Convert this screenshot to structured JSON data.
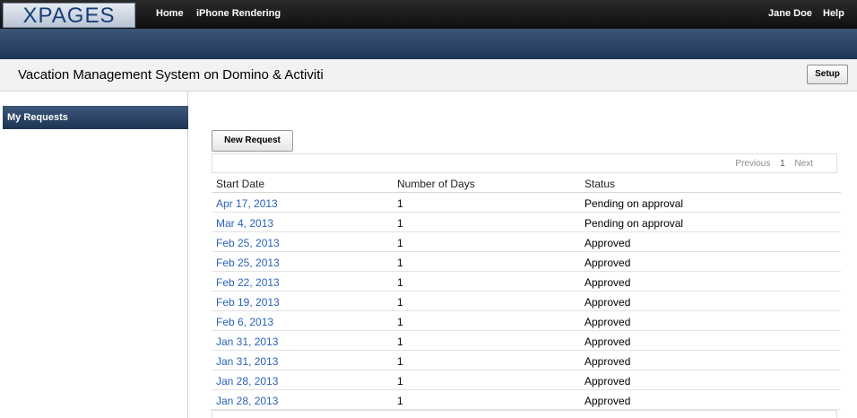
{
  "banner": {
    "logo_text": "XPAGES",
    "nav": [
      "Home",
      "iPhone Rendering"
    ],
    "user": "Jane Doe",
    "help": "Help"
  },
  "placebar": {
    "title": "Vacation Management System on Domino & Activiti",
    "setup_label": "Setup"
  },
  "leftnav": {
    "items": [
      {
        "label": "My Requests",
        "selected": true
      }
    ]
  },
  "main": {
    "new_request_label": "New Request",
    "pager": {
      "previous": "Previous",
      "current": "1",
      "next": "Next"
    },
    "columns": [
      "Start Date",
      "Number of Days",
      "Status"
    ],
    "rows": [
      {
        "date": "Apr 17, 2013",
        "days": "1",
        "status": "Pending on approval"
      },
      {
        "date": "Mar 4, 2013",
        "days": "1",
        "status": "Pending on approval"
      },
      {
        "date": "Feb 25, 2013",
        "days": "1",
        "status": "Approved"
      },
      {
        "date": "Feb 25, 2013",
        "days": "1",
        "status": "Approved"
      },
      {
        "date": "Feb 22, 2013",
        "days": "1",
        "status": "Approved"
      },
      {
        "date": "Feb 19, 2013",
        "days": "1",
        "status": "Approved"
      },
      {
        "date": "Feb 6, 2013",
        "days": "1",
        "status": "Approved"
      },
      {
        "date": "Jan 31, 2013",
        "days": "1",
        "status": "Approved"
      },
      {
        "date": "Jan 31, 2013",
        "days": "1",
        "status": "Approved"
      },
      {
        "date": "Jan 28, 2013",
        "days": "1",
        "status": "Approved"
      },
      {
        "date": "Jan 28, 2013",
        "days": "1",
        "status": "Approved"
      }
    ]
  },
  "colors": {
    "banner": "#1a1a1a",
    "titlebar": "#2e4668",
    "link": "#2a62b8",
    "nav_selected": "#2c4566"
  }
}
